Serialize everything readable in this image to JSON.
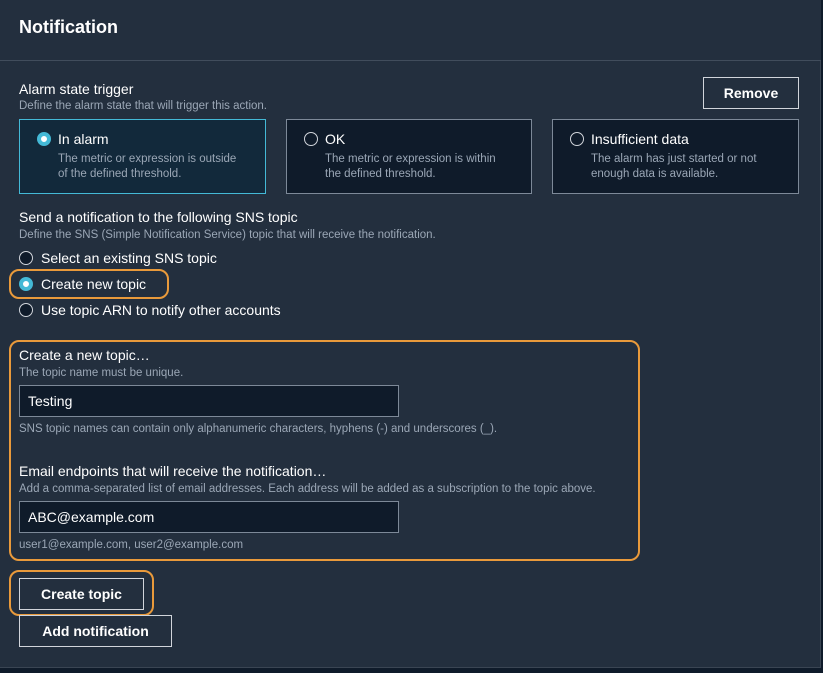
{
  "header": {
    "title": "Notification"
  },
  "alarm_state": {
    "label": "Alarm state trigger",
    "description": "Define the alarm state that will trigger this action.",
    "remove_label": "Remove",
    "tiles": [
      {
        "title": "In alarm",
        "line1": "The metric or expression is outside",
        "line2": "of the defined threshold.",
        "selected": true
      },
      {
        "title": "OK",
        "line1": "The metric or expression is within",
        "line2": "the defined threshold.",
        "selected": false
      },
      {
        "title": "Insufficient data",
        "line1": "The alarm has just started or not",
        "line2": "enough data is available.",
        "selected": false
      }
    ]
  },
  "sns": {
    "label": "Send a notification to the following SNS topic",
    "description": "Define the SNS (Simple Notification Service) topic that will receive the notification.",
    "options": [
      {
        "label": "Select an existing SNS topic",
        "selected": false
      },
      {
        "label": "Create new topic",
        "selected": true
      },
      {
        "label": "Use topic ARN to notify other accounts",
        "selected": false
      }
    ]
  },
  "new_topic": {
    "label": "Create a new topic…",
    "description": "The topic name must be unique.",
    "value": "Testing",
    "constraint": "SNS topic names can contain only alphanumeric characters, hyphens (-) and underscores (_)."
  },
  "email": {
    "label": "Email endpoints that will receive the notification…",
    "description": "Add a comma-separated list of email addresses. Each address will be added as a subscription to the topic above.",
    "value": "ABC@example.com",
    "hint": "user1@example.com, user2@example.com"
  },
  "actions": {
    "create_topic_label": "Create topic",
    "add_notification_label": "Add notification"
  },
  "colors": {
    "accent": "#44b9d6",
    "highlight": "#e99a3b",
    "panel": "#232f3e",
    "field": "#0f1b2a"
  }
}
